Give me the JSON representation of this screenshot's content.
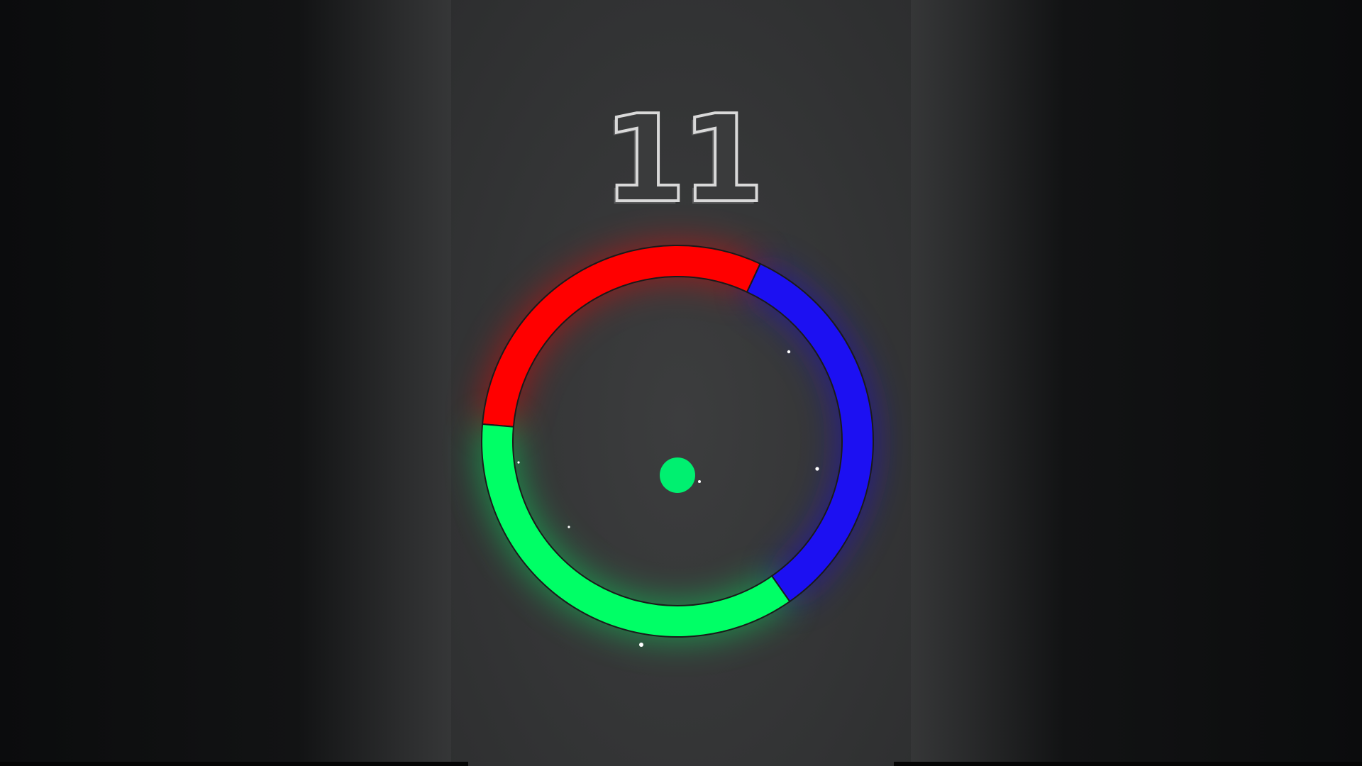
{
  "game": {
    "score": "11",
    "ring": {
      "segments": [
        {
          "name": "red",
          "color": "#ff0000",
          "start_deg": 185,
          "end_deg": 295
        },
        {
          "name": "blue",
          "color": "#1c10f2",
          "start_deg": 295,
          "end_deg": 415
        },
        {
          "name": "green",
          "color": "#00ff66",
          "start_deg": 55,
          "end_deg": 185
        }
      ]
    },
    "player_ball_color": "#00f070",
    "colors": {
      "red": "#ff0000",
      "blue": "#1c10f2",
      "green": "#00ff66",
      "score_outline": "#d9d9d9"
    }
  }
}
